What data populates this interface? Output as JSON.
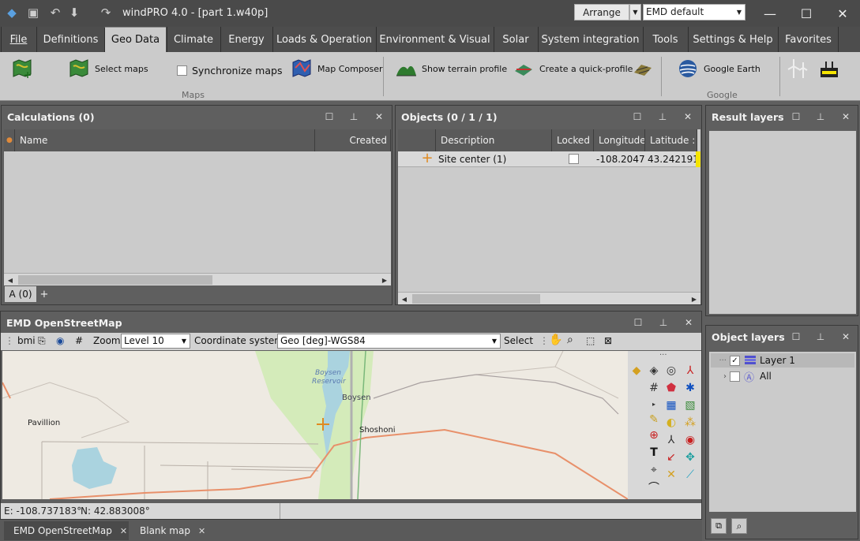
{
  "window": {
    "title": "windPRO 4.0 - [part 1.w40p]",
    "arrange_label": "Arrange",
    "layout_value": "EMD default"
  },
  "menu": {
    "tabs": [
      "File",
      "Definitions",
      "Geo Data",
      "Climate",
      "Energy",
      "Loads & Operation",
      "Environment & Visual",
      "Solar",
      "System integration",
      "Tools",
      "Settings & Help",
      "Favorites"
    ],
    "active": "Geo Data"
  },
  "ribbon": {
    "select_maps": "Select maps",
    "synchronize_maps": "Synchronize maps",
    "map_composer": "Map Composer",
    "show_terrain_profile": "Show terrain profile",
    "create_quick_profile": "Create a quick-profile",
    "google_earth": "Google Earth",
    "group_maps": "Maps",
    "group_google": "Google"
  },
  "calculations": {
    "title": "Calculations (0)",
    "col_name": "Name",
    "col_created": "Created",
    "tab_label": "A (0)",
    "add_tab": "+"
  },
  "objects": {
    "title": "Objects (0 / 1 / 1)",
    "columns": [
      "Description",
      "Locked",
      "Longitude",
      "Latitude :"
    ],
    "rows": [
      {
        "description": "Site center (1)",
        "locked": false,
        "longitude": "-108.2047",
        "latitude": "43.242191"
      }
    ]
  },
  "result_layers": {
    "title": "Result layers"
  },
  "object_layers": {
    "title": "Object layers",
    "items": [
      {
        "label": "Layer 1",
        "checked": true
      },
      {
        "label": "All",
        "checked": false
      }
    ]
  },
  "map": {
    "title": "EMD OpenStreetMap",
    "toolbar_bmi": "bmi",
    "zoom_label": "Zoom",
    "zoom_value": "Level 10",
    "coord_label": "Coordinate system",
    "coord_value": "Geo [deg]-WGS84",
    "select_label": "Select",
    "places": {
      "reservoir_1": "Boysen",
      "reservoir_2": "Reservoir",
      "boysen": "Boysen",
      "shoshoni": "Shoshoni",
      "pavillion": "Pavillion"
    },
    "tools_more": "···"
  },
  "status": {
    "east": "E: -108.737183°",
    "north": "N: 42.883008°"
  },
  "doc_tabs": [
    {
      "label": "EMD OpenStreetMap",
      "active": true
    },
    {
      "label": "Blank map",
      "active": false
    }
  ],
  "colors": {
    "dark_bg": "#5f5f5f",
    "ribbon_bg": "#cbcbcb",
    "accent_yellow": "#f5e400",
    "road_orange": "#e8906a",
    "water_blue": "#aad3df",
    "green_area": "#cdebb0"
  }
}
